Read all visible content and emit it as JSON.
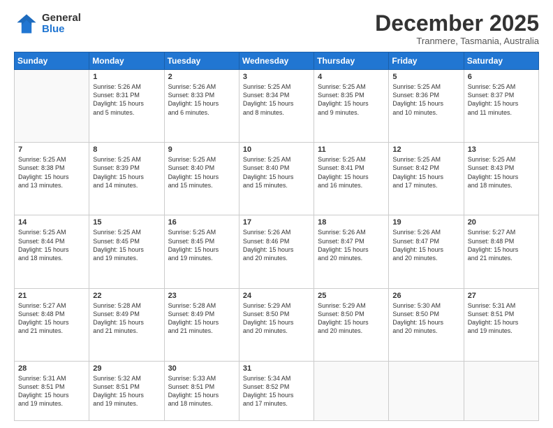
{
  "logo": {
    "general": "General",
    "blue": "Blue"
  },
  "title": "December 2025",
  "location": "Tranmere, Tasmania, Australia",
  "days_of_week": [
    "Sunday",
    "Monday",
    "Tuesday",
    "Wednesday",
    "Thursday",
    "Friday",
    "Saturday"
  ],
  "weeks": [
    [
      {
        "day": "",
        "detail": ""
      },
      {
        "day": "1",
        "detail": "Sunrise: 5:26 AM\nSunset: 8:31 PM\nDaylight: 15 hours\nand 5 minutes."
      },
      {
        "day": "2",
        "detail": "Sunrise: 5:26 AM\nSunset: 8:33 PM\nDaylight: 15 hours\nand 6 minutes."
      },
      {
        "day": "3",
        "detail": "Sunrise: 5:25 AM\nSunset: 8:34 PM\nDaylight: 15 hours\nand 8 minutes."
      },
      {
        "day": "4",
        "detail": "Sunrise: 5:25 AM\nSunset: 8:35 PM\nDaylight: 15 hours\nand 9 minutes."
      },
      {
        "day": "5",
        "detail": "Sunrise: 5:25 AM\nSunset: 8:36 PM\nDaylight: 15 hours\nand 10 minutes."
      },
      {
        "day": "6",
        "detail": "Sunrise: 5:25 AM\nSunset: 8:37 PM\nDaylight: 15 hours\nand 11 minutes."
      }
    ],
    [
      {
        "day": "7",
        "detail": "Sunrise: 5:25 AM\nSunset: 8:38 PM\nDaylight: 15 hours\nand 13 minutes."
      },
      {
        "day": "8",
        "detail": "Sunrise: 5:25 AM\nSunset: 8:39 PM\nDaylight: 15 hours\nand 14 minutes."
      },
      {
        "day": "9",
        "detail": "Sunrise: 5:25 AM\nSunset: 8:40 PM\nDaylight: 15 hours\nand 15 minutes."
      },
      {
        "day": "10",
        "detail": "Sunrise: 5:25 AM\nSunset: 8:40 PM\nDaylight: 15 hours\nand 15 minutes."
      },
      {
        "day": "11",
        "detail": "Sunrise: 5:25 AM\nSunset: 8:41 PM\nDaylight: 15 hours\nand 16 minutes."
      },
      {
        "day": "12",
        "detail": "Sunrise: 5:25 AM\nSunset: 8:42 PM\nDaylight: 15 hours\nand 17 minutes."
      },
      {
        "day": "13",
        "detail": "Sunrise: 5:25 AM\nSunset: 8:43 PM\nDaylight: 15 hours\nand 18 minutes."
      }
    ],
    [
      {
        "day": "14",
        "detail": "Sunrise: 5:25 AM\nSunset: 8:44 PM\nDaylight: 15 hours\nand 18 minutes."
      },
      {
        "day": "15",
        "detail": "Sunrise: 5:25 AM\nSunset: 8:45 PM\nDaylight: 15 hours\nand 19 minutes."
      },
      {
        "day": "16",
        "detail": "Sunrise: 5:25 AM\nSunset: 8:45 PM\nDaylight: 15 hours\nand 19 minutes."
      },
      {
        "day": "17",
        "detail": "Sunrise: 5:26 AM\nSunset: 8:46 PM\nDaylight: 15 hours\nand 20 minutes."
      },
      {
        "day": "18",
        "detail": "Sunrise: 5:26 AM\nSunset: 8:47 PM\nDaylight: 15 hours\nand 20 minutes."
      },
      {
        "day": "19",
        "detail": "Sunrise: 5:26 AM\nSunset: 8:47 PM\nDaylight: 15 hours\nand 20 minutes."
      },
      {
        "day": "20",
        "detail": "Sunrise: 5:27 AM\nSunset: 8:48 PM\nDaylight: 15 hours\nand 21 minutes."
      }
    ],
    [
      {
        "day": "21",
        "detail": "Sunrise: 5:27 AM\nSunset: 8:48 PM\nDaylight: 15 hours\nand 21 minutes."
      },
      {
        "day": "22",
        "detail": "Sunrise: 5:28 AM\nSunset: 8:49 PM\nDaylight: 15 hours\nand 21 minutes."
      },
      {
        "day": "23",
        "detail": "Sunrise: 5:28 AM\nSunset: 8:49 PM\nDaylight: 15 hours\nand 21 minutes."
      },
      {
        "day": "24",
        "detail": "Sunrise: 5:29 AM\nSunset: 8:50 PM\nDaylight: 15 hours\nand 20 minutes."
      },
      {
        "day": "25",
        "detail": "Sunrise: 5:29 AM\nSunset: 8:50 PM\nDaylight: 15 hours\nand 20 minutes."
      },
      {
        "day": "26",
        "detail": "Sunrise: 5:30 AM\nSunset: 8:50 PM\nDaylight: 15 hours\nand 20 minutes."
      },
      {
        "day": "27",
        "detail": "Sunrise: 5:31 AM\nSunset: 8:51 PM\nDaylight: 15 hours\nand 19 minutes."
      }
    ],
    [
      {
        "day": "28",
        "detail": "Sunrise: 5:31 AM\nSunset: 8:51 PM\nDaylight: 15 hours\nand 19 minutes."
      },
      {
        "day": "29",
        "detail": "Sunrise: 5:32 AM\nSunset: 8:51 PM\nDaylight: 15 hours\nand 19 minutes."
      },
      {
        "day": "30",
        "detail": "Sunrise: 5:33 AM\nSunset: 8:51 PM\nDaylight: 15 hours\nand 18 minutes."
      },
      {
        "day": "31",
        "detail": "Sunrise: 5:34 AM\nSunset: 8:52 PM\nDaylight: 15 hours\nand 17 minutes."
      },
      {
        "day": "",
        "detail": ""
      },
      {
        "day": "",
        "detail": ""
      },
      {
        "day": "",
        "detail": ""
      }
    ]
  ]
}
